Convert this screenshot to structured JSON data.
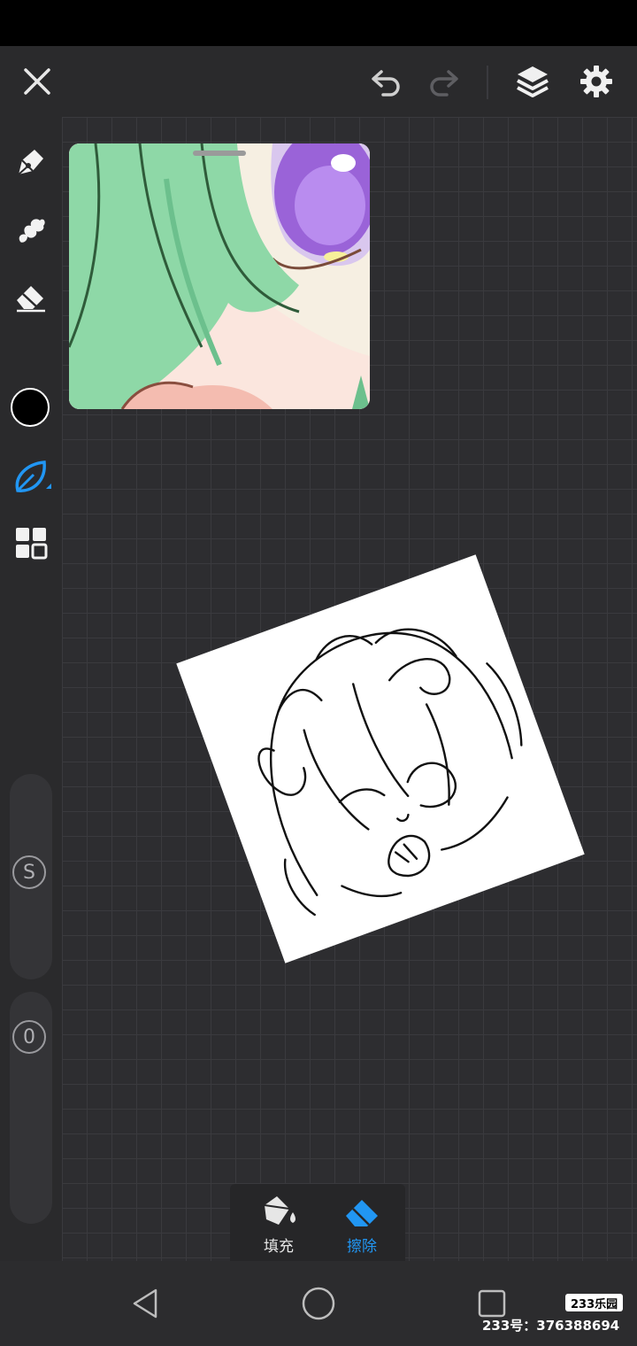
{
  "toolbar": {
    "close_icon": "close-icon",
    "undo_icon": "undo-icon",
    "redo_icon": "redo-icon",
    "layers_icon": "layers-icon",
    "settings_icon": "gear-icon"
  },
  "sidebar": {
    "tools": [
      "pen-icon",
      "smudge-icon",
      "eraser-icon",
      "color-swatch",
      "brush-leaf-icon",
      "grid-icon"
    ],
    "current_color": "#000000",
    "accent_color": "#2196f3",
    "size_slider_label": "S",
    "opacity_slider_label": "0"
  },
  "fill_panel": {
    "fill_label": "填充",
    "erase_label": "擦除",
    "active_tool": "erase"
  },
  "watermark": {
    "badge": "233乐园",
    "text": "233号：376388694"
  }
}
